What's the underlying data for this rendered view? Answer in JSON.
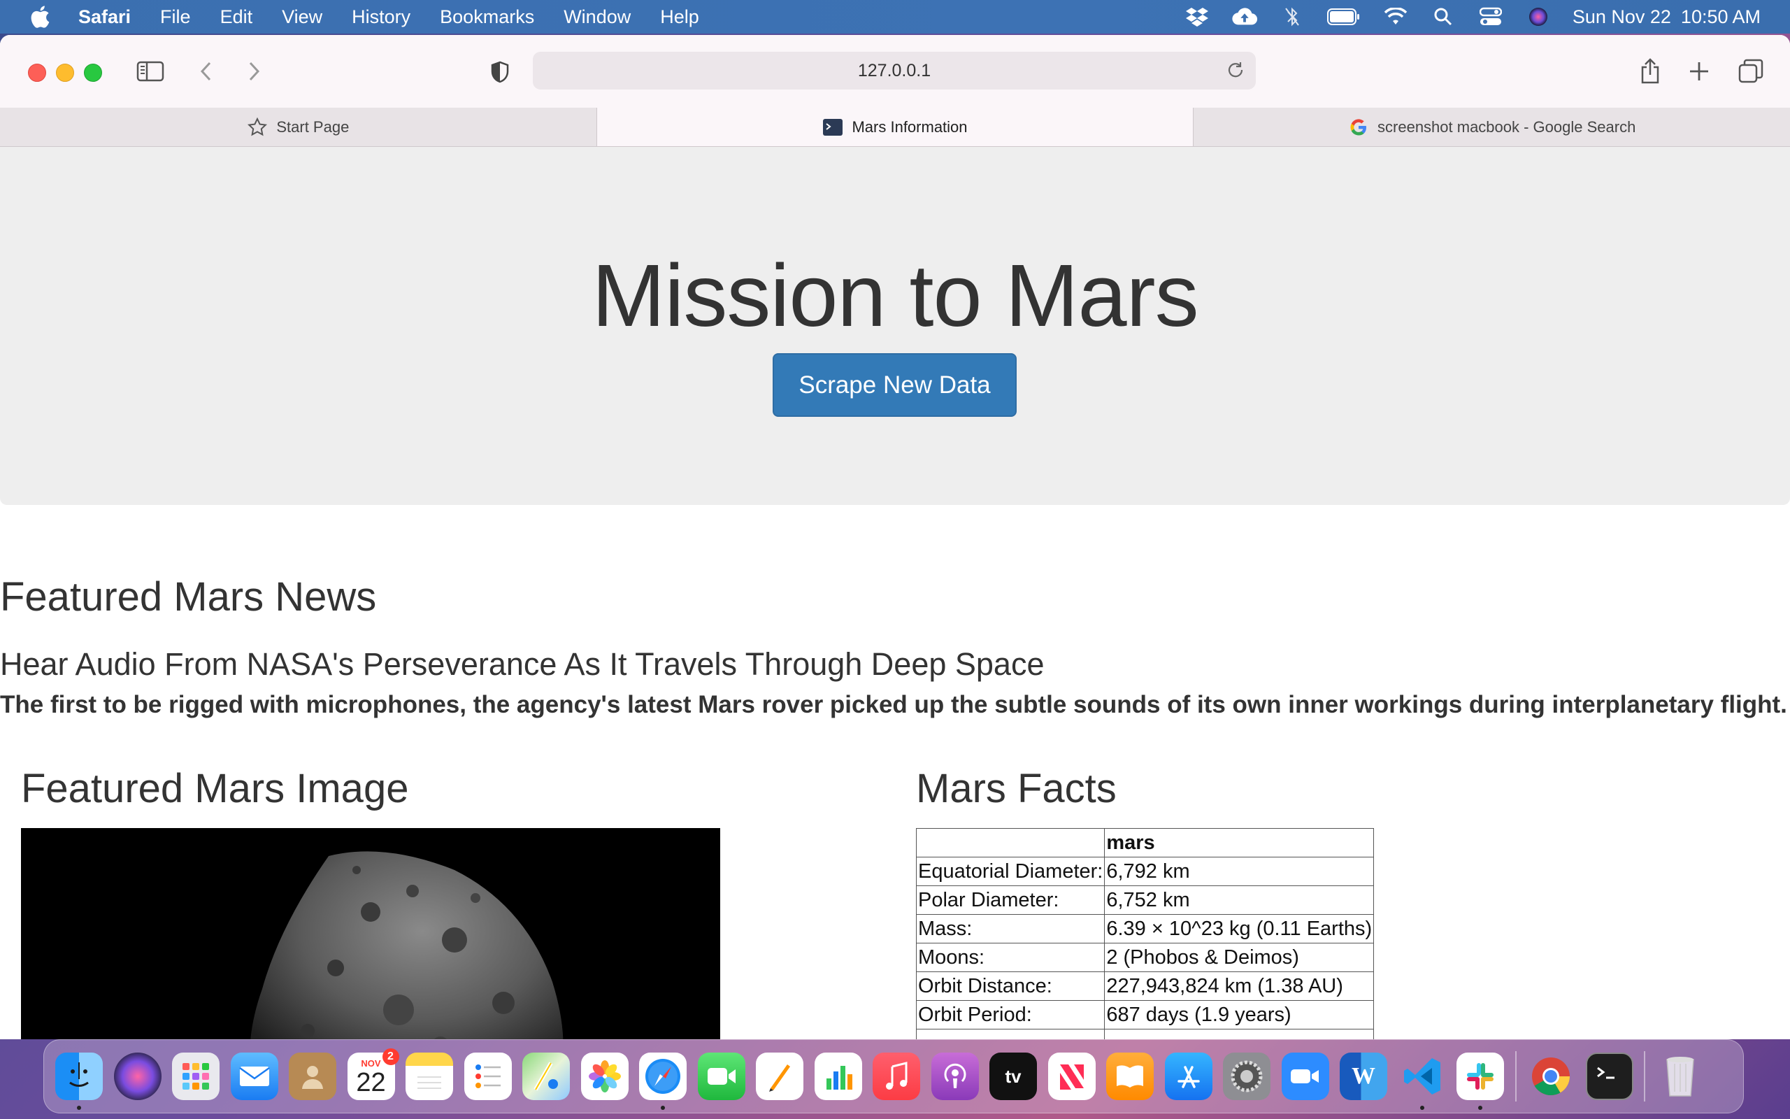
{
  "menubar": {
    "app_name": "Safari",
    "items": [
      "File",
      "Edit",
      "View",
      "History",
      "Bookmarks",
      "Window",
      "Help"
    ],
    "date": "Sun Nov 22",
    "time": "10:50 AM"
  },
  "browser": {
    "url": "127.0.0.1",
    "tabs": [
      {
        "label": "Start Page",
        "icon": "star-icon"
      },
      {
        "label": "Mars Information",
        "icon": "terminal-icon"
      },
      {
        "label": "screenshot macbook - Google Search",
        "icon": "google-icon"
      }
    ]
  },
  "page": {
    "title": "Mission to Mars",
    "scrape_button": "Scrape New Data",
    "news_heading": "Featured Mars News",
    "news_title": "Hear Audio From NASA's Perseverance As It Travels Through Deep Space",
    "news_teaser": "The first to be rigged with microphones, the agency's latest Mars rover picked up the subtle sounds of its own inner workings during interplanetary flight.",
    "image_heading": "Featured Mars Image",
    "facts_heading": "Mars Facts",
    "facts_table": {
      "header": [
        "",
        "mars"
      ],
      "rows": [
        [
          "Equatorial Diameter:",
          "6,792 km"
        ],
        [
          "Polar Diameter:",
          "6,752 km"
        ],
        [
          "Mass:",
          "6.39 × 10^23 kg (0.11 Earths)"
        ],
        [
          "Moons:",
          "2 (Phobos & Deimos)"
        ],
        [
          "Orbit Distance:",
          "227,943,824 km (1.38 AU)"
        ],
        [
          "Orbit Period:",
          "687 days (1.9 years)"
        ]
      ]
    }
  },
  "dock": {
    "calendar_month": "NOV",
    "calendar_day": "22",
    "calendar_badge": "2",
    "apps": [
      "Finder",
      "Siri",
      "Launchpad",
      "Mail",
      "Contacts",
      "Calendar",
      "Notes",
      "Reminders",
      "Maps",
      "Photos",
      "Safari",
      "FaceTime",
      "Pages",
      "Numbers",
      "Music",
      "Podcasts",
      "TV",
      "News",
      "Books",
      "App Store",
      "System Preferences",
      "Zoom",
      "Word",
      "VS Code",
      "Slack",
      "Chrome",
      "Terminal",
      "Trash"
    ],
    "tv_label": "tv"
  },
  "colors": {
    "accent": "#337ab7",
    "jumbotron_bg": "#eeeeee",
    "menubar_bg": "#3b6fb0"
  }
}
